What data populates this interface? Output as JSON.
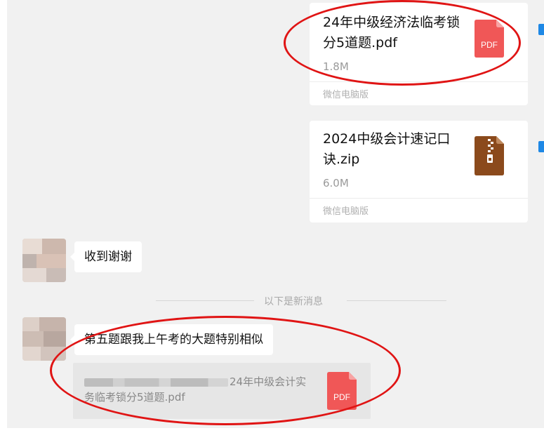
{
  "messages": {
    "file1": {
      "title": "24年中级经济法临考锁分5道题.pdf",
      "size": "1.8M",
      "source": "微信电脑版",
      "icon": "pdf-icon",
      "icon_label": "PDF"
    },
    "file2": {
      "title": "2024中级会计速记口诀.zip",
      "size": "6.0M",
      "source": "微信电脑版",
      "icon": "zip-icon"
    },
    "reply1": {
      "text": "收到谢谢"
    },
    "divider": {
      "label": "以下是新消息"
    },
    "reply2": {
      "text": "第五题跟我上午考的大题特别相似"
    },
    "quote": {
      "text": "24年中级会计实务临考锁分5道题.pdf",
      "icon": "pdf-icon",
      "icon_label": "PDF"
    }
  },
  "colors": {
    "annotation": "#e01414",
    "pdf": "#f05757",
    "zip": "#8b4a1c",
    "chat_bg": "#f1f1f1"
  }
}
